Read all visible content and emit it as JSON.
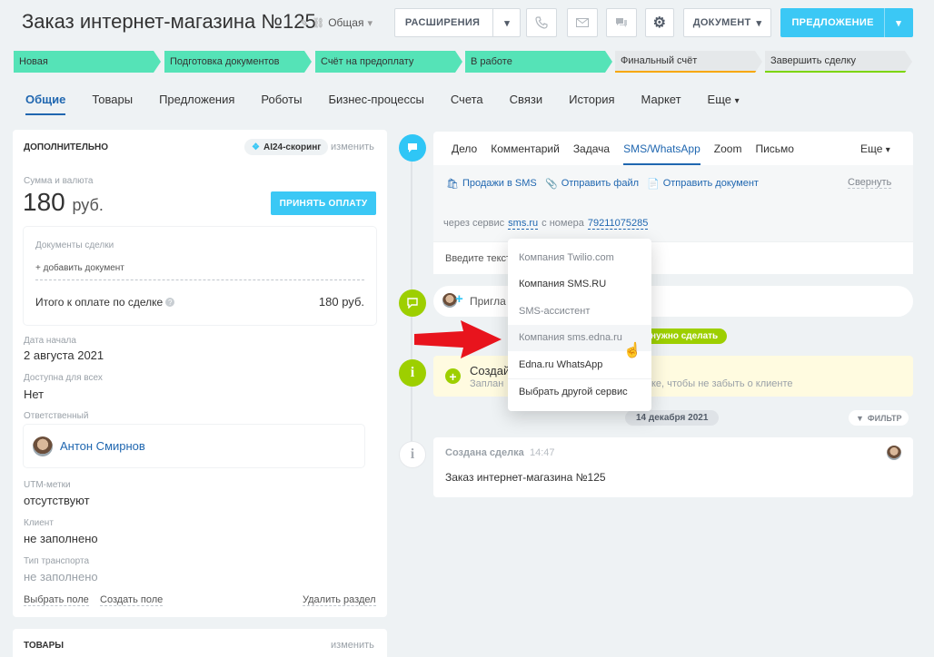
{
  "header": {
    "title": "Заказ интернет-магазина №125",
    "category": "Общая",
    "ext_label": "РАСШИРЕНИЯ",
    "doc_label": "ДОКУМЕНТ",
    "offer_label": "ПРЕДЛОЖЕНИЕ"
  },
  "stages": [
    {
      "label": "Новая",
      "color": "#55e3b7"
    },
    {
      "label": "Подготовка документов",
      "color": "#55e3b7"
    },
    {
      "label": "Счёт на предоплату",
      "color": "#55e3b7"
    },
    {
      "label": "В работе",
      "color": "#55e3b7"
    },
    {
      "label": "Финальный счёт",
      "color": "#f7a700"
    },
    {
      "label": "Завершить сделку",
      "color": "#7bd500"
    }
  ],
  "tabs": [
    "Общие",
    "Товары",
    "Предложения",
    "Роботы",
    "Бизнес-процессы",
    "Счета",
    "Связи",
    "История",
    "Маркет",
    "Еще"
  ],
  "left": {
    "section_title": "ДОПОЛНИТЕЛЬНО",
    "ai_badge": "AI24-скоринг",
    "change": "изменить",
    "amount_label": "Сумма и валюта",
    "amount": "180",
    "currency": "руб.",
    "pay_button": "ПРИНЯТЬ ОПЛАТУ",
    "docs_label": "Документы сделки",
    "add_doc": "+ добавить документ",
    "total_label": "Итого к оплате по сделке",
    "total_value": "180 руб.",
    "start_label": "Дата начала",
    "start_value": "2 августа 2021",
    "avail_label": "Доступна для всех",
    "avail_value": "Нет",
    "resp_label": "Ответственный",
    "resp_name": "Антон Смирнов",
    "utm_label": "UTM-метки",
    "utm_value": "отсутствуют",
    "client_label": "Клиент",
    "client_value": "не заполнено",
    "transport_label": "Тип транспорта",
    "transport_value": "не заполнено",
    "select_field": "Выбрать поле",
    "create_field": "Создать поле",
    "delete_section": "Удалить раздел",
    "goods_title": "ТОВАРЫ",
    "goods_change": "изменить"
  },
  "timeline": {
    "tabs": [
      "Дело",
      "Комментарий",
      "Задача",
      "SMS/WhatsApp",
      "Zoom",
      "Письмо",
      "Еще"
    ],
    "sms_sales": "Продажи в SMS",
    "send_file": "Отправить файл",
    "send_doc": "Отправить документ",
    "collapse": "Свернуть",
    "via_service": "через сервис",
    "service": "sms.ru",
    "from_number": "с номера",
    "phone": "79211075285",
    "input_placeholder": "Введите текст",
    "invite": "Пригла",
    "todo_badge": "нужно сделать",
    "create_title": "Создай",
    "create_hint_a": "Заплан",
    "create_hint_b": "ке, чтобы не забыть о клиенте",
    "date_pill": "14 декабря 2021",
    "filter": "ФИЛЬТР",
    "created_label": "Создана сделка",
    "created_time": "14:47",
    "created_deal": "Заказ интернет-магазина №125"
  },
  "dropdown": [
    "Компания Twilio.com",
    "Компания SMS.RU",
    "SMS-ассистент",
    "Компания sms.edna.ru",
    "Edna.ru WhatsApp",
    "Выбрать другой сервис"
  ],
  "colors": {
    "accent": "#3bc8f5",
    "link": "#2067b0",
    "stage_done": "#55e3b7",
    "arrow": "#e8141d"
  }
}
